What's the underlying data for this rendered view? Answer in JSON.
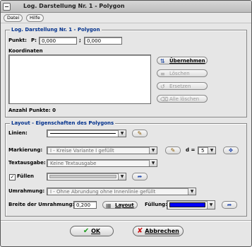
{
  "window": {
    "title": "Log. Darstellung Nr. 1 - Polygon"
  },
  "menu": {
    "items": [
      "Datei",
      "Hilfe"
    ]
  },
  "polygon_group": {
    "legend": "Log. Darstellung Nr. 1 - Polygon",
    "point_label": "Punkt:",
    "p_label": "P:",
    "x_value": "0,000",
    "separator": ";",
    "y_value": "0,000",
    "coords_label": "Koordinaten",
    "buttons": {
      "take": "Übernehmen",
      "delete": "Löschen",
      "replace": "Ersetzen",
      "delete_all": "Alle löschen"
    },
    "count_label": "Anzahl Punkte: 0"
  },
  "layout_group": {
    "legend": "Layout - Eigenschaften des Polygons",
    "lines_label": "Linien:",
    "marking_label": "Markierung:",
    "marking_value": "I - Kreise Variante I gefüllt",
    "d_label": "d =",
    "d_value": "5",
    "text_label": "Textausgabe:",
    "text_value": "Keine Textausgabe",
    "fill_label": "Füllen",
    "fill_checked": true,
    "border_label": "Umrahmung:",
    "border_value": "I - Ohne Abrundung ohne Innenlinie gefüllt",
    "border_width_label": "Breite der Umrahmung:",
    "border_width_value": "0,200",
    "layout_button": "Layout",
    "filling_label": "Füllung:",
    "filling_color": "#0000ff"
  },
  "footer": {
    "ok": "OK",
    "cancel": "Abbrechen"
  }
}
